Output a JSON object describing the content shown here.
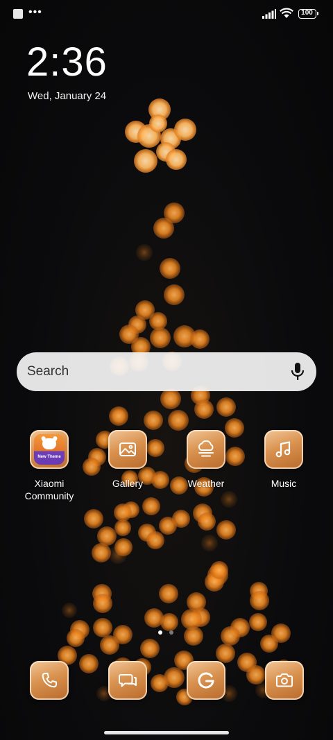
{
  "status_bar": {
    "battery": "100"
  },
  "lockscreen": {
    "time": "2:36",
    "date": "Wed, January 24"
  },
  "search": {
    "placeholder": "Search"
  },
  "apps": [
    {
      "label": "Xiaomi\nCommunity",
      "icon": "xiaomi-community-icon"
    },
    {
      "label": "Gallery",
      "icon": "gallery-icon"
    },
    {
      "label": "Weather",
      "icon": "weather-icon"
    },
    {
      "label": "Music",
      "icon": "music-icon"
    }
  ],
  "community_badge": "New Theme",
  "dock": [
    {
      "icon": "phone-icon"
    },
    {
      "icon": "messages-icon"
    },
    {
      "icon": "google-icon"
    },
    {
      "icon": "camera-icon"
    }
  ],
  "pages": {
    "count": 2,
    "current": 1
  },
  "colors": {
    "icon_gold_light": "#f2c79a",
    "icon_gold_dark": "#b86a2c",
    "bokeh": "#f08a22"
  }
}
